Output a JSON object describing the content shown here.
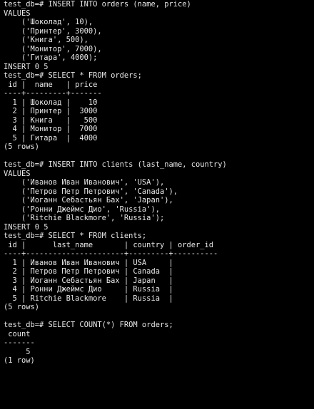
{
  "terminal": {
    "lines": [
      "test_db=# INSERT INTO orders (name, price)",
      "VALUES",
      "    ('Шоколад', 10),",
      "    ('Принтер', 3000),",
      "    ('Книга', 500),",
      "    ('Монитор', 7000),",
      "    ('Гитара', 4000);",
      "INSERT 0 5",
      "test_db=# SELECT * FROM orders;",
      " id |  name   | price",
      "----+---------+-------",
      "  1 | Шоколад |    10",
      "  2 | Принтер |  3000",
      "  3 | Книга   |   500",
      "  4 | Монитор |  7000",
      "  5 | Гитара  |  4000",
      "(5 rows)",
      "",
      "test_db=# INSERT INTO clients (last_name, country)",
      "VALUES",
      "    ('Иванов Иван Иванович', 'USA'),",
      "    ('Петров Петр Петрович', 'Canada'),",
      "    ('Иоганн Себастьян Бах', 'Japan'),",
      "    ('Ронни Джеймс Дио', 'Russia'),",
      "    ('Ritchie Blackmore', 'Russia');",
      "INSERT 0 5",
      "test_db=# SELECT * FROM clients;",
      " id |      last_name       | country | order_id",
      "----+----------------------+---------+----------",
      "  1 | Иванов Иван Иванович | USA     |",
      "  2 | Петров Петр Петрович | Canada  |",
      "  3 | Иоганн Себастьян Бах | Japan   |",
      "  4 | Ронни Джеймс Дио     | Russia  |",
      "  5 | Ritchie Blackmore    | Russia  |",
      "(5 rows)",
      "",
      "test_db=# SELECT COUNT(*) FROM orders;",
      " count",
      "-------",
      "     5",
      "(1 row)"
    ]
  },
  "colors": {
    "background": "#000000",
    "text": "#e8e8e8"
  }
}
